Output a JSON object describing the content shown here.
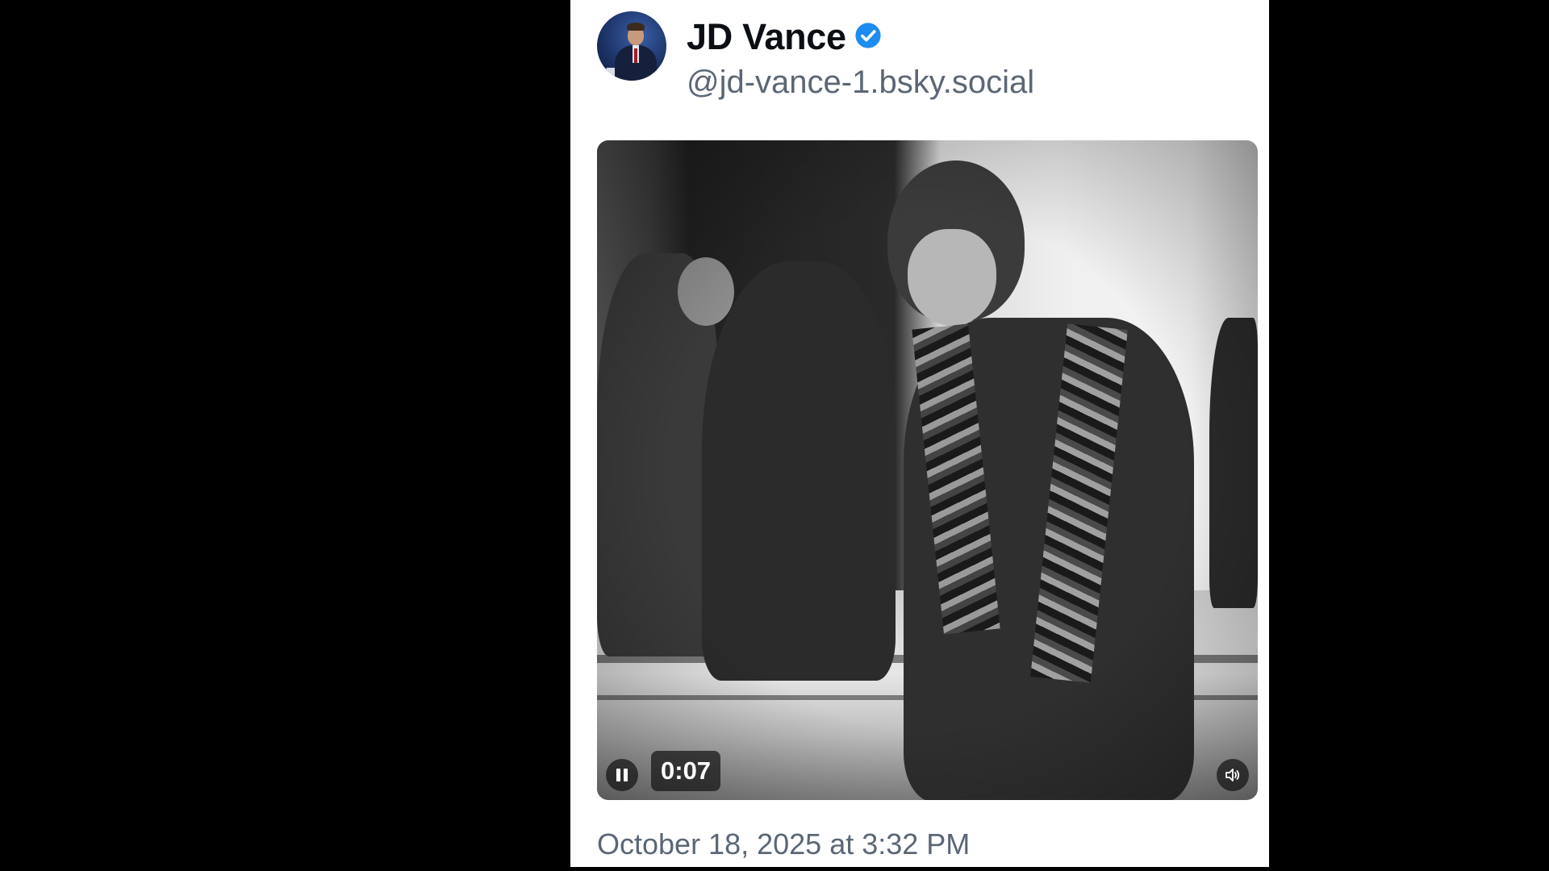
{
  "post": {
    "author": {
      "display_name": "JD Vance",
      "handle": "@jd-vance-1.bsky.social",
      "verified": true,
      "verified_color": "#1d8cf0"
    },
    "video": {
      "elapsed": "0:07",
      "state": "playing",
      "muted": false
    },
    "timestamp": "October 18, 2025 at 3:32 PM"
  },
  "icons": {
    "avatar": "avatar",
    "verified": "verified-badge-icon",
    "pause": "pause-icon",
    "volume": "volume-icon"
  }
}
